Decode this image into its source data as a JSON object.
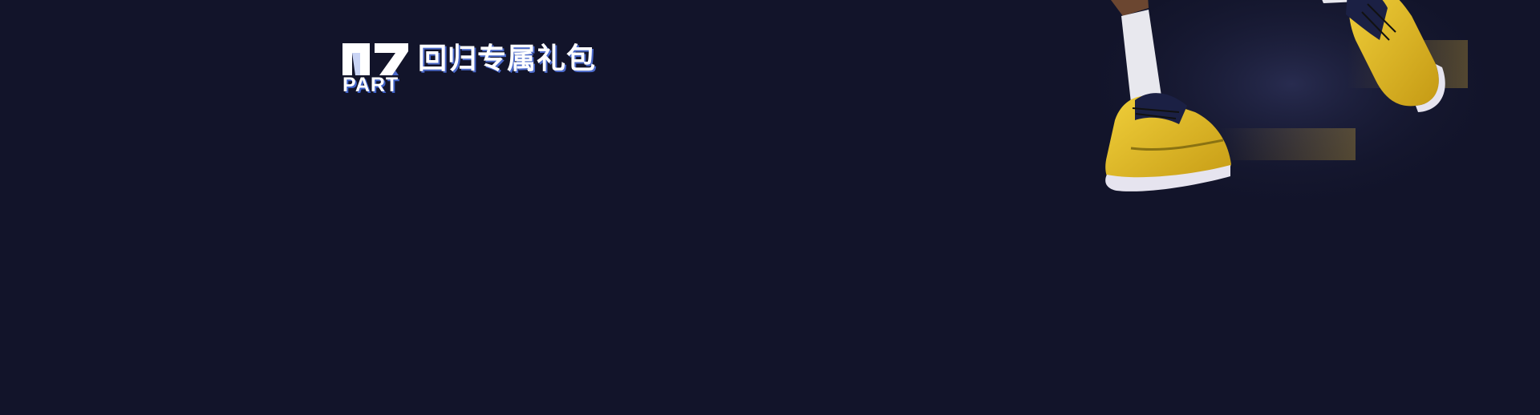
{
  "section": {
    "number": "07",
    "part_label": "PART",
    "title": "回归专属礼包"
  },
  "colors": {
    "background": "#12142a",
    "title_text": "#ffffff",
    "title_shadow": "#4a68c8",
    "shoe_yellow": "#e8c022",
    "shoe_navy": "#1b2044",
    "sock_white": "#e8e8ee"
  },
  "decor": {
    "player_image": "basketball-player-legs-sneakers"
  }
}
